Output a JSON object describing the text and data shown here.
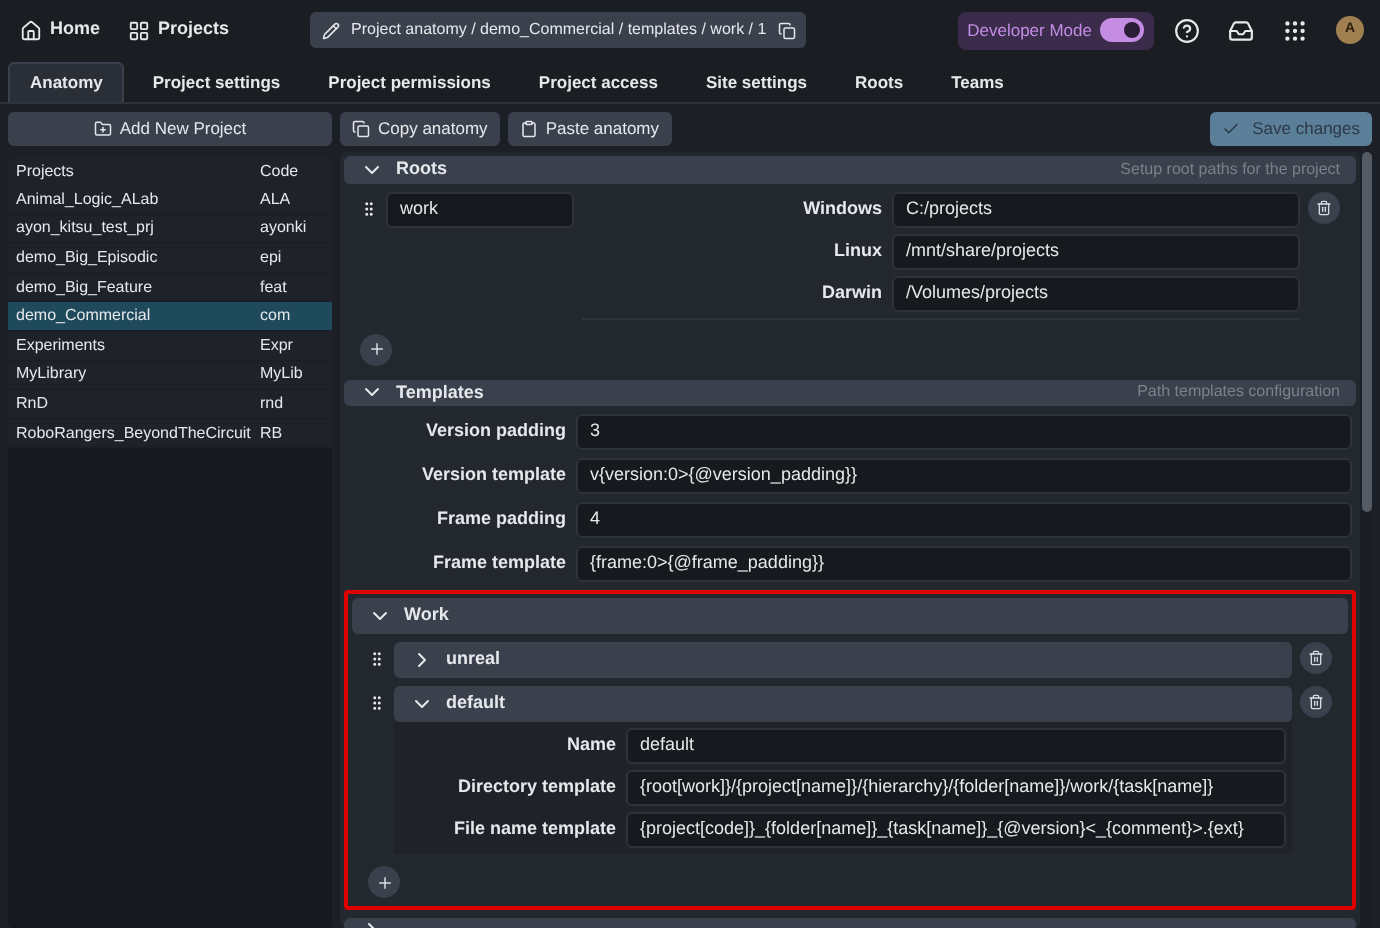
{
  "topbar": {
    "home": "Home",
    "projects": "Projects",
    "breadcrumb": "Project anatomy / demo_Commercial / templates / work / 1",
    "developer_mode": {
      "label": "Developer Mode",
      "on": true
    },
    "avatar": "A"
  },
  "tabs": [
    {
      "label": "Anatomy",
      "selected": true
    },
    {
      "label": "Project settings",
      "selected": false
    },
    {
      "label": "Project permissions",
      "selected": false
    },
    {
      "label": "Project access",
      "selected": false
    },
    {
      "label": "Site settings",
      "selected": false
    },
    {
      "label": "Roots",
      "selected": false
    },
    {
      "label": "Teams",
      "selected": false
    }
  ],
  "sidebar": {
    "add_button": "Add New Project",
    "columns": [
      "Projects",
      "Code"
    ],
    "projects": [
      {
        "name": "Animal_Logic_ALab",
        "code": "ALA",
        "selected": false
      },
      {
        "name": "ayon_kitsu_test_prj",
        "code": "ayonki",
        "selected": false
      },
      {
        "name": "demo_Big_Episodic",
        "code": "epi",
        "selected": false
      },
      {
        "name": "demo_Big_Feature",
        "code": "feat",
        "selected": false
      },
      {
        "name": "demo_Commercial",
        "code": "com",
        "selected": true
      },
      {
        "name": "Experiments",
        "code": "Expr",
        "selected": false
      },
      {
        "name": "MyLibrary",
        "code": "MyLib",
        "selected": false
      },
      {
        "name": "RnD",
        "code": "rnd",
        "selected": false
      },
      {
        "name": "RoboRangers_BeyondTheCircuit",
        "code": "RB",
        "selected": false
      }
    ]
  },
  "toolbar": {
    "copy": "Copy anatomy",
    "paste": "Paste anatomy",
    "save": {
      "label": "Save changes",
      "disabled": true
    }
  },
  "roots": {
    "title": "Roots",
    "hint": "Setup root paths for the project",
    "expanded": true,
    "items": [
      {
        "name": "work",
        "paths": [
          {
            "label": "Windows",
            "value": "C:/projects"
          },
          {
            "label": "Linux",
            "value": "/mnt/share/projects"
          },
          {
            "label": "Darwin",
            "value": "/Volumes/projects"
          }
        ]
      }
    ]
  },
  "templates": {
    "title": "Templates",
    "hint": "Path templates configuration",
    "expanded": true,
    "fields": [
      {
        "label": "Version padding",
        "value": "3"
      },
      {
        "label": "Version template",
        "value": "v{version:0>{@version_padding}}"
      },
      {
        "label": "Frame padding",
        "value": "4"
      },
      {
        "label": "Frame template",
        "value": "{frame:0>{@frame_padding}}"
      }
    ]
  },
  "work": {
    "title": "Work",
    "expanded": true,
    "highlighted": true,
    "items": [
      {
        "name": "unreal",
        "expanded": false
      },
      {
        "name": "default",
        "expanded": true,
        "fields": [
          {
            "label": "Name",
            "value": "default"
          },
          {
            "label": "Directory template",
            "value": "{root[work]}/{project[name]}/{hierarchy}/{folder[name]}/work/{task[name]}"
          },
          {
            "label": "File name template",
            "value": "{project[code]}_{folder[name]}_{task[name]}_{@version}<_{comment}>.{ext}"
          }
        ]
      }
    ]
  },
  "next_section": {
    "expanded": false
  }
}
